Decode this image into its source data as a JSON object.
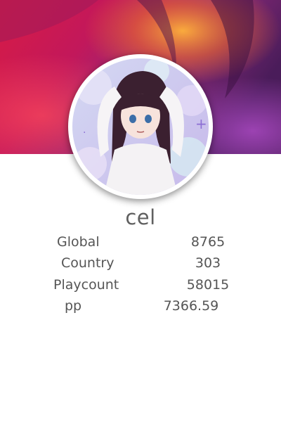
{
  "profile": {
    "username": "cel",
    "colors": {
      "banner_magenta": "#c2185b",
      "banner_orange": "#f5a623",
      "banner_purple": "#4a1c5a",
      "ring": "#ffffff",
      "text": "#555555"
    }
  },
  "stats": [
    {
      "label": "Global",
      "value": "8765"
    },
    {
      "label": "Country",
      "value": "303"
    },
    {
      "label": "Playcount",
      "value": "58015"
    },
    {
      "label": "pp",
      "value": "7366.59"
    }
  ]
}
